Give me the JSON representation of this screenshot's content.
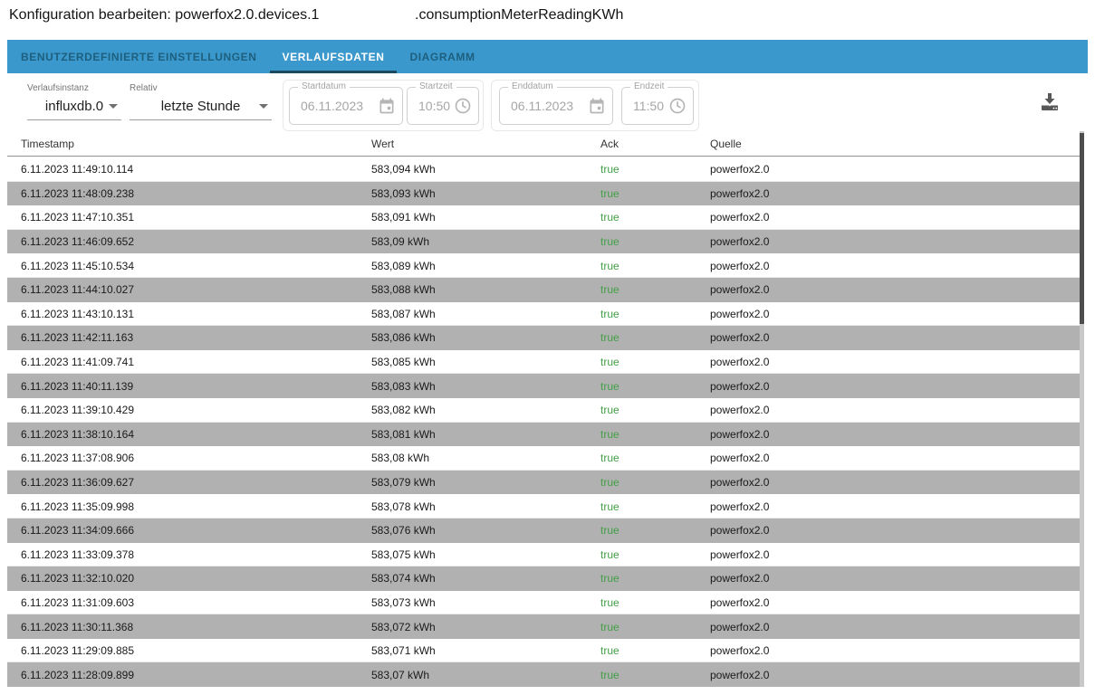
{
  "title": {
    "prefix": "Konfiguration bearbeiten: powerfox2.0.devices.1",
    "suffix": ".consumptionMeterReadingKWh"
  },
  "tabs": [
    {
      "label": "BENUTZERDEFINIERTE EINSTELLUNGEN",
      "active": false
    },
    {
      "label": "VERLAUFSDATEN",
      "active": true
    },
    {
      "label": "DIAGRAMM",
      "active": false
    }
  ],
  "filters": {
    "instance": {
      "label": "Verlaufsinstanz",
      "value": "influxdb.0"
    },
    "relative": {
      "label": "Relativ",
      "value": "letzte Stunde"
    },
    "start_date": {
      "label": "Startdatum",
      "value": "06.11.2023"
    },
    "start_time": {
      "label": "Startzeit",
      "value": "10:50"
    },
    "end_date": {
      "label": "Enddatum",
      "value": "06.11.2023"
    },
    "end_time": {
      "label": "Endzeit",
      "value": "11:50"
    },
    "export_icon": "download-icon"
  },
  "table": {
    "columns": [
      "Timestamp",
      "Wert",
      "Ack",
      "Quelle"
    ],
    "rows": [
      {
        "ts": "6.11.2023 11:49:10.114",
        "wert": "583,094 kWh",
        "ack": "true",
        "quelle": "powerfox2.0"
      },
      {
        "ts": "6.11.2023 11:48:09.238",
        "wert": "583,093 kWh",
        "ack": "true",
        "quelle": "powerfox2.0"
      },
      {
        "ts": "6.11.2023 11:47:10.351",
        "wert": "583,091 kWh",
        "ack": "true",
        "quelle": "powerfox2.0"
      },
      {
        "ts": "6.11.2023 11:46:09.652",
        "wert": "583,09 kWh",
        "ack": "true",
        "quelle": "powerfox2.0"
      },
      {
        "ts": "6.11.2023 11:45:10.534",
        "wert": "583,089 kWh",
        "ack": "true",
        "quelle": "powerfox2.0"
      },
      {
        "ts": "6.11.2023 11:44:10.027",
        "wert": "583,088 kWh",
        "ack": "true",
        "quelle": "powerfox2.0"
      },
      {
        "ts": "6.11.2023 11:43:10.131",
        "wert": "583,087 kWh",
        "ack": "true",
        "quelle": "powerfox2.0"
      },
      {
        "ts": "6.11.2023 11:42:11.163",
        "wert": "583,086 kWh",
        "ack": "true",
        "quelle": "powerfox2.0"
      },
      {
        "ts": "6.11.2023 11:41:09.741",
        "wert": "583,085 kWh",
        "ack": "true",
        "quelle": "powerfox2.0"
      },
      {
        "ts": "6.11.2023 11:40:11.139",
        "wert": "583,083 kWh",
        "ack": "true",
        "quelle": "powerfox2.0"
      },
      {
        "ts": "6.11.2023 11:39:10.429",
        "wert": "583,082 kWh",
        "ack": "true",
        "quelle": "powerfox2.0"
      },
      {
        "ts": "6.11.2023 11:38:10.164",
        "wert": "583,081 kWh",
        "ack": "true",
        "quelle": "powerfox2.0"
      },
      {
        "ts": "6.11.2023 11:37:08.906",
        "wert": "583,08 kWh",
        "ack": "true",
        "quelle": "powerfox2.0"
      },
      {
        "ts": "6.11.2023 11:36:09.627",
        "wert": "583,079 kWh",
        "ack": "true",
        "quelle": "powerfox2.0"
      },
      {
        "ts": "6.11.2023 11:35:09.998",
        "wert": "583,078 kWh",
        "ack": "true",
        "quelle": "powerfox2.0"
      },
      {
        "ts": "6.11.2023 11:34:09.666",
        "wert": "583,076 kWh",
        "ack": "true",
        "quelle": "powerfox2.0"
      },
      {
        "ts": "6.11.2023 11:33:09.378",
        "wert": "583,075 kWh",
        "ack": "true",
        "quelle": "powerfox2.0"
      },
      {
        "ts": "6.11.2023 11:32:10.020",
        "wert": "583,074 kWh",
        "ack": "true",
        "quelle": "powerfox2.0"
      },
      {
        "ts": "6.11.2023 11:31:09.603",
        "wert": "583,073 kWh",
        "ack": "true",
        "quelle": "powerfox2.0"
      },
      {
        "ts": "6.11.2023 11:30:11.368",
        "wert": "583,072 kWh",
        "ack": "true",
        "quelle": "powerfox2.0"
      },
      {
        "ts": "6.11.2023 11:29:09.885",
        "wert": "583,071 kWh",
        "ack": "true",
        "quelle": "powerfox2.0"
      },
      {
        "ts": "6.11.2023 11:28:09.899",
        "wert": "583,07 kWh",
        "ack": "true",
        "quelle": "powerfox2.0"
      }
    ]
  },
  "colors": {
    "accent": "#3a98cd",
    "tab_inactive": "#1e5f7e",
    "tab_indicator": "#1c4b60",
    "row_alt": "#b1b1b1",
    "ack_true": "#43a047",
    "scrollbar_thumb": "#4d4d4d"
  }
}
